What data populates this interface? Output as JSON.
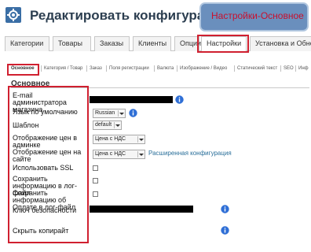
{
  "header": {
    "title": "Редактировать конфигурацию",
    "callout": "Настройки-Основное"
  },
  "main_tabs": [
    "Категории",
    "Товары",
    "Заказы",
    "Клиенты",
    "Опции",
    "Настройки",
    "Установка и Обновление"
  ],
  "sub_tabs": [
    "Основное",
    "Категория / Товар",
    "Заказ",
    "Поля регистрации",
    "Валюта",
    "Изображение / Видео",
    "Статический текст",
    "SEO",
    "Инф"
  ],
  "section": {
    "title": "Основное"
  },
  "fields": {
    "admin_email": {
      "label": "E-mail администратора магазина"
    },
    "default_language": {
      "label": "Язык по умолчанию",
      "value": "Russian"
    },
    "template": {
      "label": "Шаблон",
      "value": "default"
    },
    "admin_price_display": {
      "label": "Отображение цен в админке",
      "value": "Цена с НДС"
    },
    "site_price_display": {
      "label": "Отображение цен на сайте",
      "value": "Цена с НДС",
      "link": "Расширенная конфигурация"
    },
    "use_ssl": {
      "label": "Использовать SSL"
    },
    "save_info_log": {
      "label": "Сохранить информацию в лог-файл"
    },
    "save_payment_log": {
      "label": "Сохранить информацию об Оплате в лог-файл"
    },
    "security_key": {
      "label": "Ключ безопасности"
    },
    "hide_copyright": {
      "label": "Скрыть копирайт"
    }
  },
  "colors": {
    "highlight": "#d02030",
    "callout_bg": "#6a8fbd",
    "link": "#2a6f9a",
    "info_icon": "#2f6fd6"
  },
  "icons": [
    "gear-icon",
    "info-icon",
    "dropdown-arrow-icon"
  ]
}
